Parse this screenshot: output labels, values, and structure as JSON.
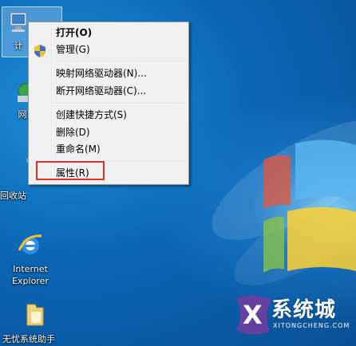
{
  "desktop": {
    "icons": [
      {
        "label": "计"
      },
      {
        "label": "网"
      },
      {
        "label": "回收站"
      },
      {
        "label": "Internet",
        "label2": "Explorer"
      },
      {
        "label": "无忧系统助手"
      }
    ]
  },
  "context_menu": {
    "items": [
      {
        "label": "打开(O)"
      },
      {
        "label": "管理(G)"
      },
      {
        "label": "映射网络驱动器(N)..."
      },
      {
        "label": "断开网络驱动器(C)..."
      },
      {
        "label": "创建快捷方式(S)"
      },
      {
        "label": "删除(D)"
      },
      {
        "label": "重命名(M)"
      },
      {
        "label": "属性(R)"
      }
    ]
  },
  "watermark": {
    "text": "系统城",
    "sub": "XITONGCHENG.COM"
  },
  "colors": {
    "highlight": "#e0302a",
    "menu_bg": "#f0f0f0"
  }
}
